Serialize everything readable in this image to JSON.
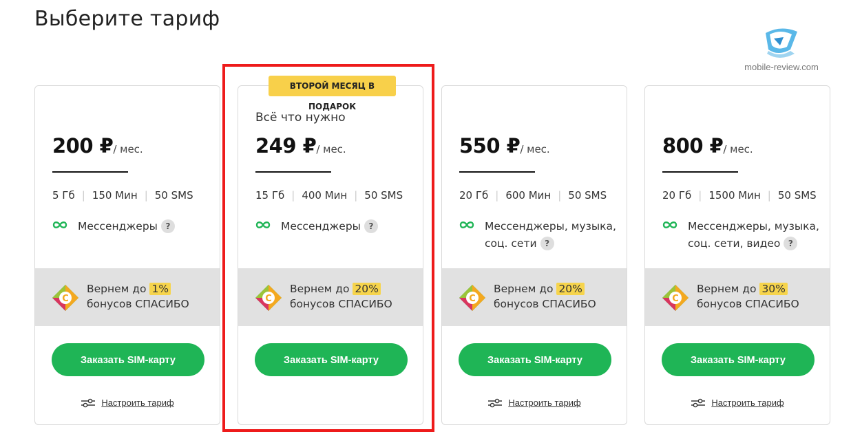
{
  "page": {
    "title": "Выберите тариф"
  },
  "watermark": {
    "text": "mobile-review.com"
  },
  "badge": {
    "label": "ВТОРОЙ МЕСЯЦ В ПОДАРОК"
  },
  "plans": [
    {
      "subtitle": "",
      "price": "200 ₽",
      "period": "/ мес.",
      "data": "5 Гб",
      "minutes": "150 Мин",
      "sms": "50 SMS",
      "feature": "Мессенджеры",
      "bonus_prefix": "Вернем до",
      "bonus_percent": "1%",
      "bonus_suffix": "бонусов СПАСИБО",
      "order_label": "Заказать SIM-карту",
      "tune_label": "Настроить тариф"
    },
    {
      "subtitle": "Всё что нужно",
      "price": "249 ₽",
      "period": "/ мес.",
      "data": "15 Гб",
      "minutes": "400 Мин",
      "sms": "50 SMS",
      "feature": "Мессенджеры",
      "bonus_prefix": "Вернем до",
      "bonus_percent": "20%",
      "bonus_suffix": "бонусов СПАСИБО",
      "order_label": "Заказать SIM-карту",
      "tune_label": ""
    },
    {
      "subtitle": "",
      "price": "550 ₽",
      "period": "/ мес.",
      "data": "20 Гб",
      "minutes": "600 Мин",
      "sms": "50 SMS",
      "feature": "Мессенджеры, музыка, соц. сети",
      "bonus_prefix": "Вернем до",
      "bonus_percent": "20%",
      "bonus_suffix": "бонусов СПАСИБО",
      "order_label": "Заказать SIM-карту",
      "tune_label": "Настроить тариф"
    },
    {
      "subtitle": "",
      "price": "800 ₽",
      "period": "/ мес.",
      "data": "20 Гб",
      "minutes": "1500 Мин",
      "sms": "50 SMS",
      "feature": "Мессенджеры, музыка, соц. сети, видео",
      "bonus_prefix": "Вернем до",
      "bonus_percent": "30%",
      "bonus_suffix": "бонусов СПАСИБО",
      "order_label": "Заказать SIM-карту",
      "tune_label": "Настроить тариф"
    }
  ],
  "icons": {
    "feature": "infinity-icon",
    "help": "question-icon",
    "bonus": "sberbank-spasibo-icon",
    "tune": "sliders-icon"
  },
  "colors": {
    "accent_green": "#1fb556",
    "badge_yellow": "#f8d04a",
    "highlight_red": "#ee1b1b",
    "bonus_band": "#e1e1e1"
  }
}
